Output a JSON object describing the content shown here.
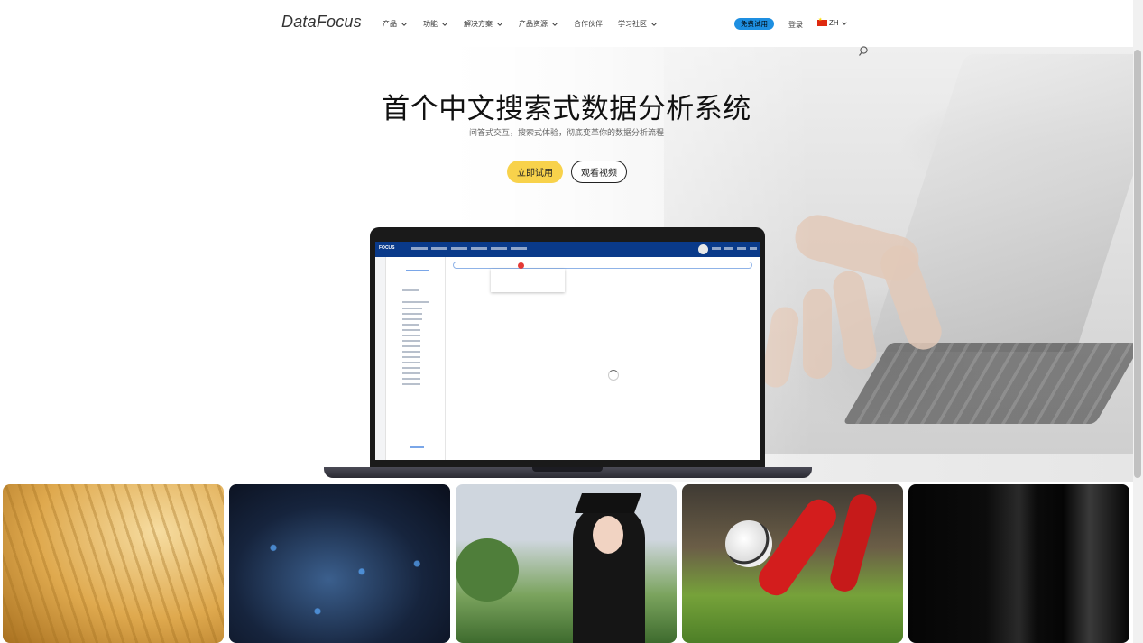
{
  "nav": {
    "logo": "DataFocus",
    "menu": [
      {
        "label": "产品"
      },
      {
        "label": "功能"
      },
      {
        "label": "解决方案"
      },
      {
        "label": "产品资源"
      },
      {
        "label": "合作伙伴"
      },
      {
        "label": "学习社区"
      }
    ],
    "trial_button": "免费试用",
    "login": "登录",
    "language": "ZH"
  },
  "hero": {
    "title": "首个中文搜索式数据分析系统",
    "subtitle": "问答式交互，搜索式体验，彻底变革你的数据分析流程",
    "try_button": "立即试用",
    "video_button": "观看视频"
  },
  "mockup": {
    "app_logo": "FOCUS"
  },
  "strip": {
    "cards": [
      "wheat-field-image",
      "city-network-image",
      "graduation-image",
      "soccer-image",
      "wine-bottle-image"
    ]
  },
  "colors": {
    "accent_blue": "#1e8fe1",
    "button_yellow": "#f8d24b",
    "app_header": "#0a3a8a"
  }
}
